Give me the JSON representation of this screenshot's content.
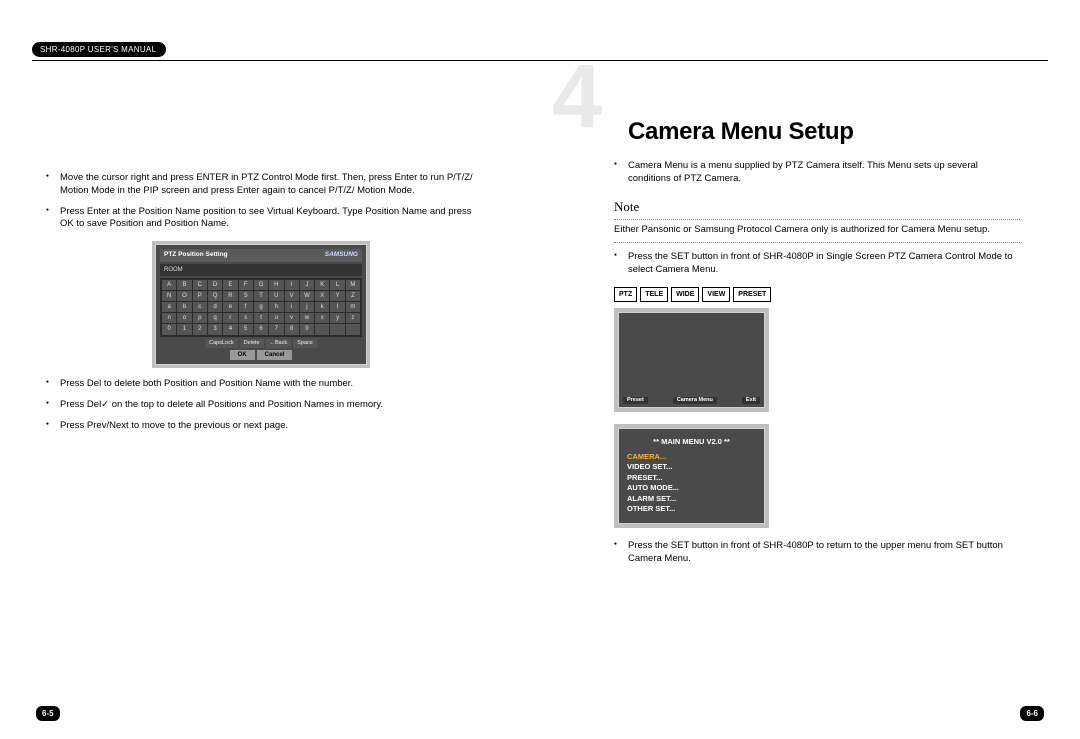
{
  "manual_header": "SHR-4080P USER'S MANUAL",
  "page_left_num": "6-5",
  "page_right_num": "6-6",
  "left": {
    "items": [
      "Move the cursor right and press ENTER in PTZ Control Mode first. Then, press Enter to run P/T/Z/ Motion Mode in the PIP screen and press Enter again to cancel P/T/Z/ Motion Mode.",
      "Press Enter at the Position Name position to see Virtual Keyboard. Type Position Name and press OK to save Position and Position Name."
    ],
    "items_after": [
      "Press Del to delete both Position and Position Name with the number.",
      "Press Del✓ on the top to delete all Positions and Position Names in memory.",
      "Press Prev/Next to move to the previous or next page."
    ],
    "vk": {
      "title": "PTZ Position Setting",
      "brand": "SAMSUNG",
      "room": "ROOM",
      "rows": [
        [
          "A",
          "B",
          "C",
          "D",
          "E",
          "F",
          "G",
          "H",
          "I",
          "J",
          "K",
          "L",
          "M"
        ],
        [
          "N",
          "O",
          "P",
          "Q",
          "R",
          "S",
          "T",
          "U",
          "V",
          "W",
          "X",
          "Y",
          "Z"
        ],
        [
          "a",
          "b",
          "c",
          "d",
          "e",
          "f",
          "g",
          "h",
          "i",
          "j",
          "k",
          "l",
          "m"
        ],
        [
          "n",
          "o",
          "p",
          "q",
          "r",
          "s",
          "t",
          "u",
          "v",
          "w",
          "x",
          "y",
          "z"
        ],
        [
          "0",
          "1",
          "2",
          "3",
          "4",
          "5",
          "6",
          "7",
          "8",
          "9",
          " ",
          " ",
          " "
        ]
      ],
      "specials": [
        "CapsLock",
        "Delete",
        "←Back",
        "Space"
      ],
      "okc": [
        "OK",
        "Cancel"
      ]
    }
  },
  "right": {
    "section_num": "4",
    "heading": "Camera Menu Setup",
    "intro": "Camera Menu is a menu supplied by PTZ Camera itself. This Menu sets up several conditions of PTZ Camera.",
    "note_label": "Note",
    "note_body": "Either Pansonic or Samsung Protocol Camera only is authorized for Camera Menu setup.",
    "step1": "Press the SET button in front of SHR-4080P in Single Screen PTZ Camera Control Mode to select Camera Menu.",
    "step2": "Press the SET button in front of SHR-4080P to return to the upper menu from SET button Camera Menu.",
    "ptz_buttons": [
      "PTZ",
      "TELE",
      "WIDE",
      "VIEW",
      "PRESET"
    ],
    "scr_footer": [
      "Preset",
      "Camera Menu",
      "Exit"
    ],
    "menu": {
      "title": "** MAIN MENU V2.0 **",
      "lines": [
        "CAMERA...",
        "VIDEO SET...",
        "PRESET...",
        "AUTO MODE...",
        "ALARM SET...",
        "OTHER SET..."
      ]
    }
  }
}
